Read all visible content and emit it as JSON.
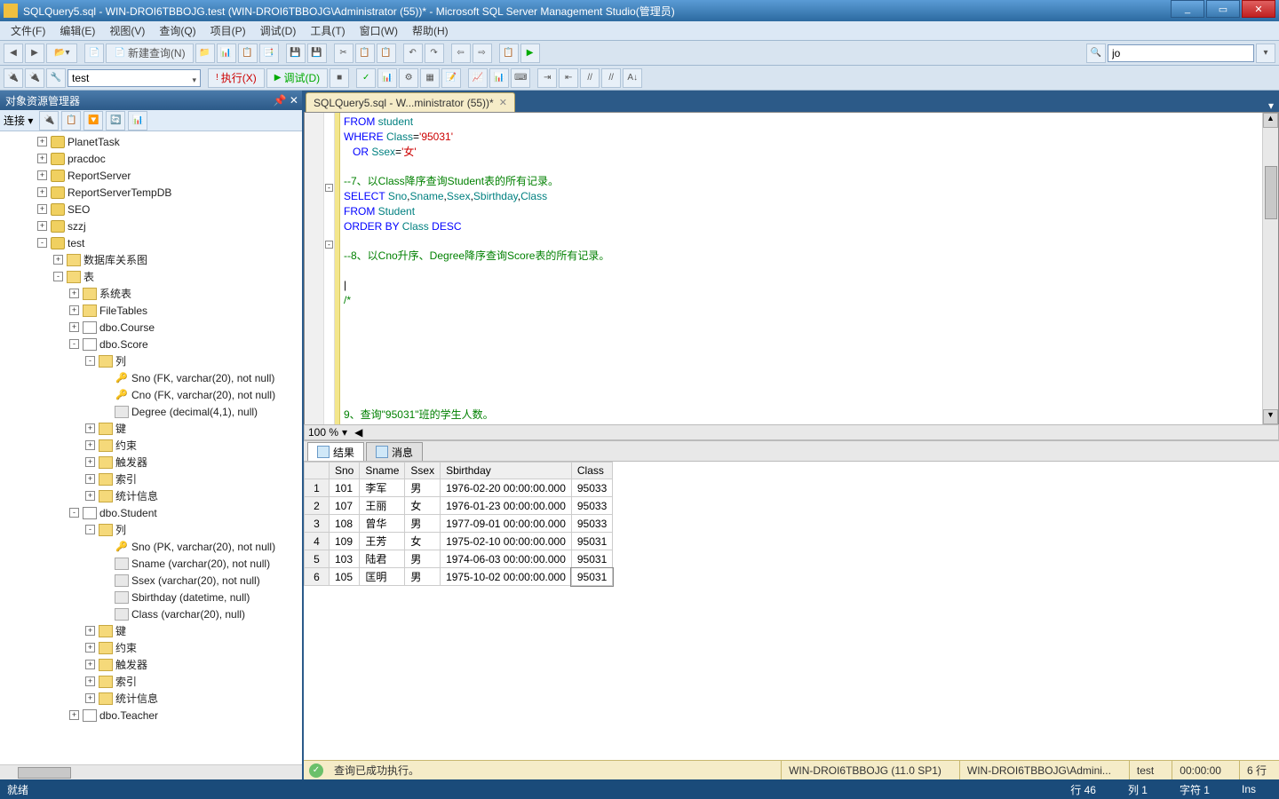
{
  "window": {
    "title": "SQLQuery5.sql - WIN-DROI6TBBOJG.test (WIN-DROI6TBBOJG\\Administrator (55))* - Microsoft SQL Server Management Studio(管理员)"
  },
  "menus": [
    "文件(F)",
    "编辑(E)",
    "视图(V)",
    "查询(Q)",
    "项目(P)",
    "调试(D)",
    "工具(T)",
    "窗口(W)",
    "帮助(H)"
  ],
  "toolbar1": {
    "new_query": "新建查询(N)",
    "search_value": "jo"
  },
  "toolbar2": {
    "db_combo": "test",
    "execute": "执行(X)",
    "debug": "调试(D)"
  },
  "explorer": {
    "title": "对象资源管理器",
    "connect": "连接 ▾",
    "nodes": [
      {
        "d": 2,
        "e": "+",
        "i": "db",
        "l": "PlanetTask"
      },
      {
        "d": 2,
        "e": "+",
        "i": "db",
        "l": "pracdoc"
      },
      {
        "d": 2,
        "e": "+",
        "i": "db",
        "l": "ReportServer"
      },
      {
        "d": 2,
        "e": "+",
        "i": "db",
        "l": "ReportServerTempDB"
      },
      {
        "d": 2,
        "e": "+",
        "i": "db",
        "l": "SEO"
      },
      {
        "d": 2,
        "e": "+",
        "i": "db",
        "l": "szzj"
      },
      {
        "d": 2,
        "e": "-",
        "i": "db",
        "l": "test"
      },
      {
        "d": 3,
        "e": "+",
        "i": "fold",
        "l": "数据库关系图"
      },
      {
        "d": 3,
        "e": "-",
        "i": "fold",
        "l": "表"
      },
      {
        "d": 4,
        "e": "+",
        "i": "fold",
        "l": "系统表"
      },
      {
        "d": 4,
        "e": "+",
        "i": "fold",
        "l": "FileTables"
      },
      {
        "d": 4,
        "e": "+",
        "i": "tbl",
        "l": "dbo.Course"
      },
      {
        "d": 4,
        "e": "-",
        "i": "tbl",
        "l": "dbo.Score"
      },
      {
        "d": 5,
        "e": "-",
        "i": "fold",
        "l": "列"
      },
      {
        "d": 6,
        "e": "",
        "i": "key",
        "l": "Sno (FK, varchar(20), not null)"
      },
      {
        "d": 6,
        "e": "",
        "i": "key",
        "l": "Cno (FK, varchar(20), not null)"
      },
      {
        "d": 6,
        "e": "",
        "i": "col",
        "l": "Degree (decimal(4,1), null)"
      },
      {
        "d": 5,
        "e": "+",
        "i": "fold",
        "l": "键"
      },
      {
        "d": 5,
        "e": "+",
        "i": "fold",
        "l": "约束"
      },
      {
        "d": 5,
        "e": "+",
        "i": "fold",
        "l": "触发器"
      },
      {
        "d": 5,
        "e": "+",
        "i": "fold",
        "l": "索引"
      },
      {
        "d": 5,
        "e": "+",
        "i": "fold",
        "l": "统计信息"
      },
      {
        "d": 4,
        "e": "-",
        "i": "tbl",
        "l": "dbo.Student"
      },
      {
        "d": 5,
        "e": "-",
        "i": "fold",
        "l": "列"
      },
      {
        "d": 6,
        "e": "",
        "i": "key",
        "l": "Sno (PK, varchar(20), not null)"
      },
      {
        "d": 6,
        "e": "",
        "i": "col",
        "l": "Sname (varchar(20), not null)"
      },
      {
        "d": 6,
        "e": "",
        "i": "col",
        "l": "Ssex (varchar(20), not null)"
      },
      {
        "d": 6,
        "e": "",
        "i": "col",
        "l": "Sbirthday (datetime, null)"
      },
      {
        "d": 6,
        "e": "",
        "i": "col",
        "l": "Class (varchar(20), null)"
      },
      {
        "d": 5,
        "e": "+",
        "i": "fold",
        "l": "键"
      },
      {
        "d": 5,
        "e": "+",
        "i": "fold",
        "l": "约束"
      },
      {
        "d": 5,
        "e": "+",
        "i": "fold",
        "l": "触发器"
      },
      {
        "d": 5,
        "e": "+",
        "i": "fold",
        "l": "索引"
      },
      {
        "d": 5,
        "e": "+",
        "i": "fold",
        "l": "统计信息"
      },
      {
        "d": 4,
        "e": "+",
        "i": "tbl",
        "l": "dbo.Teacher"
      }
    ]
  },
  "tab": {
    "label": "SQLQuery5.sql - W...ministrator (55))*"
  },
  "code_lines": [
    {
      "t": "kw",
      "v": "FROM "
    },
    {
      "t": "obj",
      "v": "student"
    },
    {
      "br": 1
    },
    {
      "t": "kw",
      "v": "WHERE "
    },
    {
      "t": "obj",
      "v": "Class"
    },
    {
      "t": "",
      "v": "="
    },
    {
      "t": "str",
      "v": "'95031'"
    },
    {
      "br": 1
    },
    {
      "t": "",
      "v": "   "
    },
    {
      "t": "kw",
      "v": "OR "
    },
    {
      "t": "obj",
      "v": "Ssex"
    },
    {
      "t": "",
      "v": "="
    },
    {
      "t": "str",
      "v": "'女'"
    },
    {
      "br": 1
    },
    {
      "br": 1
    },
    {
      "t": "cmt",
      "v": "--7、以Class降序查询Student表的所有记录。"
    },
    {
      "br": 1
    },
    {
      "t": "kw",
      "v": "SELECT "
    },
    {
      "t": "obj",
      "v": "Sno"
    },
    {
      "t": "",
      "v": ","
    },
    {
      "t": "obj",
      "v": "Sname"
    },
    {
      "t": "",
      "v": ","
    },
    {
      "t": "obj",
      "v": "Ssex"
    },
    {
      "t": "",
      "v": ","
    },
    {
      "t": "obj",
      "v": "Sbirthday"
    },
    {
      "t": "",
      "v": ","
    },
    {
      "t": "obj",
      "v": "Class"
    },
    {
      "br": 1
    },
    {
      "t": "kw",
      "v": "FROM "
    },
    {
      "t": "obj",
      "v": "Student"
    },
    {
      "br": 1
    },
    {
      "t": "kw",
      "v": "ORDER BY "
    },
    {
      "t": "obj",
      "v": "Class"
    },
    {
      "t": "",
      "v": " "
    },
    {
      "t": "kw",
      "v": "DESC"
    },
    {
      "br": 1
    },
    {
      "br": 1
    },
    {
      "t": "cmt",
      "v": "--8、以Cno升序、Degree降序查询Score表的所有记录。"
    },
    {
      "br": 1
    },
    {
      "br": 1
    },
    {
      "t": "",
      "v": "|"
    },
    {
      "br": 1
    },
    {
      "t": "cmt",
      "v": "/*"
    },
    {
      "br": 1
    },
    {
      "br": 1
    },
    {
      "br": 1
    },
    {
      "br": 1
    },
    {
      "br": 1
    },
    {
      "br": 1
    },
    {
      "br": 1
    },
    {
      "br": 1
    },
    {
      "t": "cmt",
      "v": "9、查询\"95031\"班的学生人数。"
    }
  ],
  "zoom": "100 %",
  "results": {
    "tab1": "结果",
    "tab2": "消息",
    "headers": [
      "",
      "Sno",
      "Sname",
      "Ssex",
      "Sbirthday",
      "Class"
    ],
    "rows": [
      [
        "1",
        "101",
        "李军",
        "男",
        "1976-02-20 00:00:00.000",
        "95033"
      ],
      [
        "2",
        "107",
        "王丽",
        "女",
        "1976-01-23 00:00:00.000",
        "95033"
      ],
      [
        "3",
        "108",
        "曾华",
        "男",
        "1977-09-01 00:00:00.000",
        "95033"
      ],
      [
        "4",
        "109",
        "王芳",
        "女",
        "1975-02-10 00:00:00.000",
        "95031"
      ],
      [
        "5",
        "103",
        "陆君",
        "男",
        "1974-06-03 00:00:00.000",
        "95031"
      ],
      [
        "6",
        "105",
        "匡明",
        "男",
        "1975-10-02 00:00:00.000",
        "95031"
      ]
    ]
  },
  "resstatus": {
    "msg": "查询已成功执行。",
    "server": "WIN-DROI6TBBOJG (11.0 SP1)",
    "user": "WIN-DROI6TBBOJG\\Admini...",
    "db": "test",
    "time": "00:00:00",
    "rows": "6 行"
  },
  "status": {
    "ready": "就绪",
    "line": "行 46",
    "col": "列 1",
    "ch": "字符 1",
    "ins": "Ins"
  }
}
